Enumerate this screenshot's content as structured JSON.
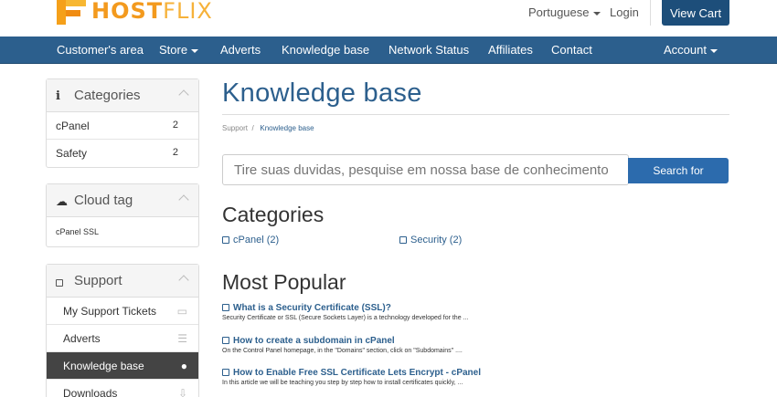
{
  "header": {
    "logo_text_a": "HOST",
    "logo_text_b": "FLIX",
    "language": "Portuguese",
    "login": "Login",
    "view_cart": "View Cart"
  },
  "nav": {
    "items": [
      "Customer's area",
      "Store",
      "Adverts",
      "Knowledge base",
      "Network Status",
      "Affiliates",
      "Contact"
    ],
    "account": "Account"
  },
  "sidebar": {
    "categories": {
      "title": "Categories",
      "items": [
        {
          "label": "cPanel",
          "count": "2"
        },
        {
          "label": "Safety",
          "count": "2"
        }
      ]
    },
    "cloud": {
      "title": "Cloud tag",
      "items": [
        {
          "label": "cPanel SSL"
        }
      ]
    },
    "support": {
      "title": "Support",
      "items": [
        {
          "label": "My Support Tickets"
        },
        {
          "label": "Adverts"
        },
        {
          "label": "Knowledge base"
        },
        {
          "label": "Downloads"
        }
      ]
    }
  },
  "main": {
    "title": "Knowledge base",
    "breadcrumb": [
      "Support",
      "Knowledge base"
    ],
    "search_placeholder": "Tire suas duvidas, pesquise em nossa base de conhecimento",
    "search_button": "Search for",
    "categories_heading": "Categories",
    "categories": [
      "cPanel (2)",
      "Security (2)"
    ],
    "popular_heading": "Most Popular",
    "articles": [
      {
        "title": "What is a Security Certificate (SSL)?",
        "desc": "Security Certificate or SSL (Secure Sockets Layer) is a technology developed for the ..."
      },
      {
        "title": "How to create a subdomain in cPanel",
        "desc": "On the Control Panel homepage, in the \"Domains\" section, click on \"Subdomains\" ...."
      },
      {
        "title": "How to Enable Free SSL Certificate Lets Encrypt - cPanel",
        "desc": "In this article we will be teaching you step by step how to install certificates quickly, ..."
      }
    ]
  },
  "colors": {
    "navbar": "#2c5f8d",
    "button": "#1d4e7a",
    "link": "#2c5f8d",
    "logo": "#f39a1e"
  }
}
